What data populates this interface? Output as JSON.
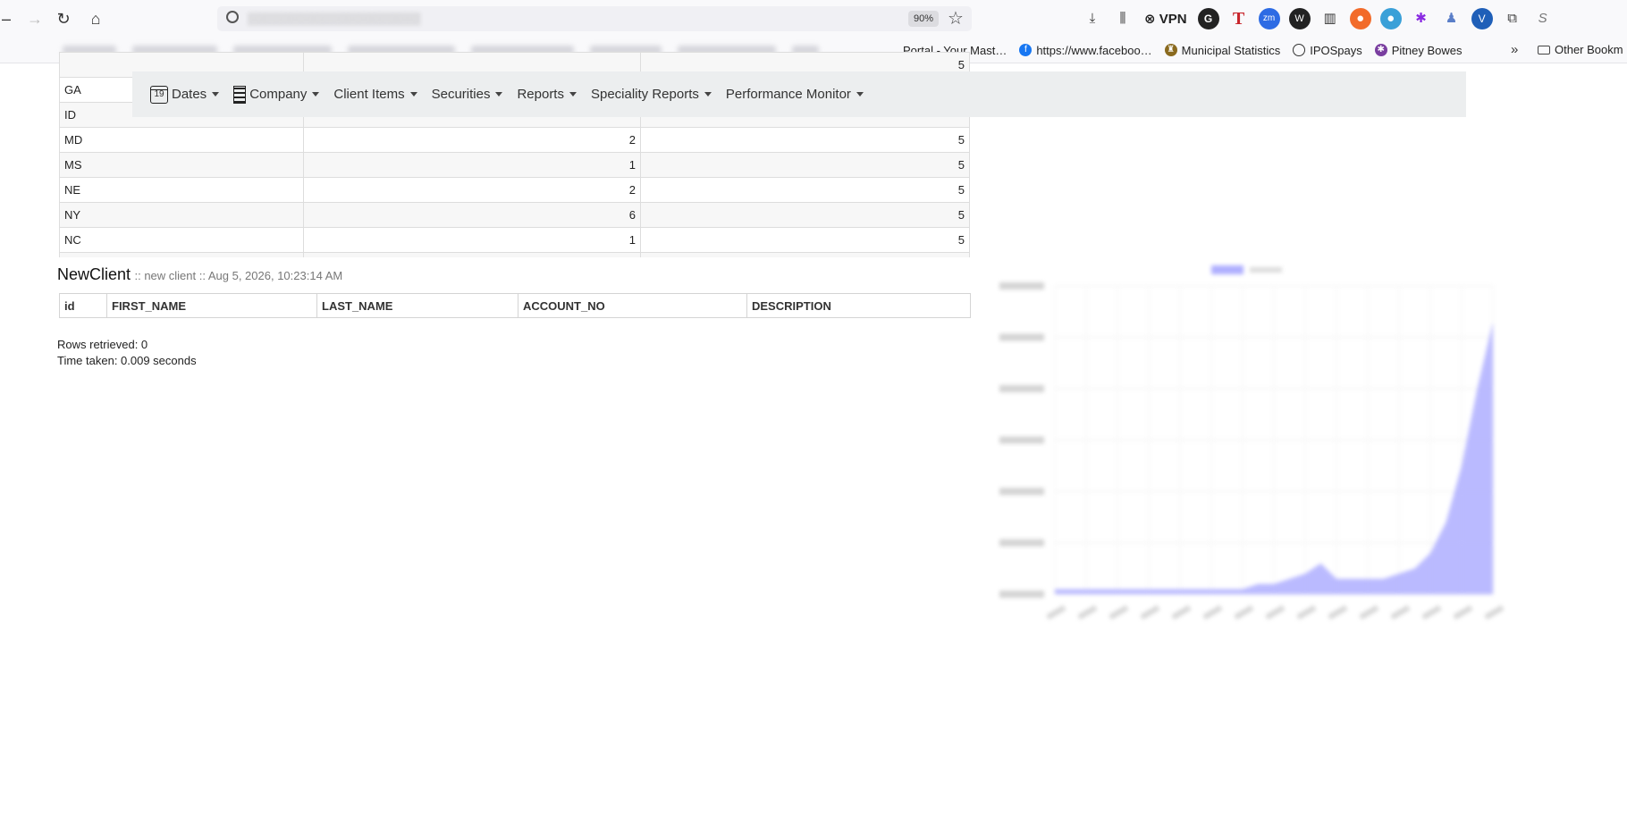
{
  "browser": {
    "zoom": "90%",
    "vpn_label": "VPN",
    "bookmarks": [
      {
        "label": "Portal - Your Mast…"
      },
      {
        "label": "https://www.faceboo…"
      },
      {
        "label": "Municipal Statistics"
      },
      {
        "label": "IPOSpays"
      },
      {
        "label": "Pitney Bowes"
      }
    ],
    "other_bookmarks": "Other Bookm"
  },
  "nav": {
    "items": [
      {
        "label": "Dates",
        "icon": "calendar-icon",
        "icon_text": "19"
      },
      {
        "label": "Company",
        "icon": "building-icon"
      },
      {
        "label": "Client Items"
      },
      {
        "label": "Securities"
      },
      {
        "label": "Reports"
      },
      {
        "label": "Speciality Reports"
      },
      {
        "label": "Performance Monitor"
      }
    ]
  },
  "state_table": {
    "rows": [
      {
        "state": "",
        "count": "",
        "value": "5"
      },
      {
        "state": "GA",
        "count": "",
        "value": ""
      },
      {
        "state": "ID",
        "count": "",
        "value": ""
      },
      {
        "state": "MD",
        "count": "2",
        "value": "5"
      },
      {
        "state": "MS",
        "count": "1",
        "value": "5"
      },
      {
        "state": "NE",
        "count": "2",
        "value": "5"
      },
      {
        "state": "NY",
        "count": "6",
        "value": "5"
      },
      {
        "state": "NC",
        "count": "1",
        "value": "5"
      },
      {
        "state": "",
        "count": "",
        "value": ""
      }
    ]
  },
  "new_client": {
    "title": "NewClient",
    "subtitle": ":: new client :: Aug 5, 2026, 10:23:14 AM",
    "columns": [
      "id",
      "FIRST_NAME",
      "LAST_NAME",
      "ACCOUNT_NO",
      "DESCRIPTION"
    ],
    "rows_retrieved": "Rows retrieved: 0",
    "time_taken": "Time taken: 0.009 seconds"
  },
  "chart_data": {
    "type": "area",
    "x": [
      1,
      2,
      3,
      4,
      5,
      6,
      7,
      8,
      9,
      10,
      11,
      12,
      13,
      14,
      15,
      16,
      17,
      18,
      19,
      20,
      21,
      22,
      23,
      24,
      25,
      26,
      27,
      28,
      29
    ],
    "values": [
      0.1,
      0.1,
      0.1,
      0.1,
      0.1,
      0.1,
      0.1,
      0.1,
      0.1,
      0.1,
      0.1,
      0.1,
      0.1,
      0.2,
      0.2,
      0.3,
      0.4,
      0.6,
      0.3,
      0.3,
      0.3,
      0.3,
      0.4,
      0.5,
      0.8,
      1.4,
      2.5,
      4.0,
      5.3
    ],
    "ylim": [
      0,
      6
    ],
    "grid": true,
    "color": "#a6a6ff"
  }
}
